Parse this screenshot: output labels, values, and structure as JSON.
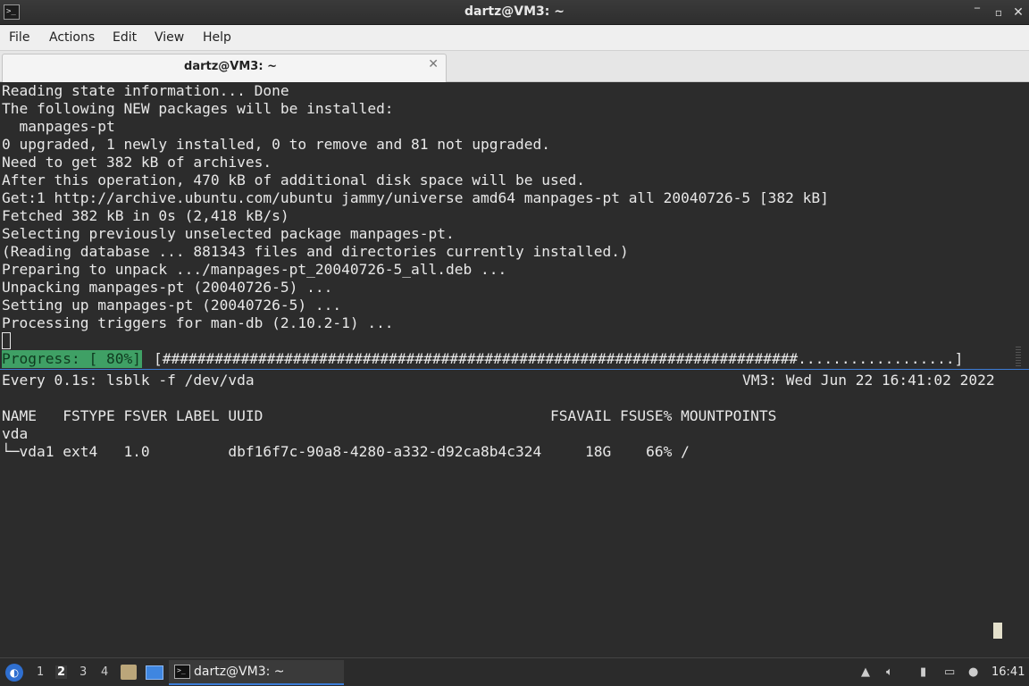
{
  "window": {
    "title": "dartz@VM3: ~",
    "icon": "terminal-icon",
    "controls": {
      "minimize": "‾",
      "maximize": "▫",
      "close": "✕"
    }
  },
  "menubar": {
    "items": [
      "File",
      "Actions",
      "Edit",
      "View",
      "Help"
    ]
  },
  "tabs": [
    {
      "label": "dartz@VM3: ~",
      "close": "✕"
    }
  ],
  "top_pane": {
    "lines": [
      "Reading state information... Done",
      "The following NEW packages will be installed:",
      "  manpages-pt",
      "0 upgraded, 1 newly installed, 0 to remove and 81 not upgraded.",
      "Need to get 382 kB of archives.",
      "After this operation, 470 kB of additional disk space will be used.",
      "Get:1 http://archive.ubuntu.com/ubuntu jammy/universe amd64 manpages-pt all 20040726-5 [382 kB]",
      "Fetched 382 kB in 0s (2,418 kB/s)",
      "Selecting previously unselected package manpages-pt.",
      "(Reading database ... 881343 files and directories currently installed.)",
      "Preparing to unpack .../manpages-pt_20040726-5_all.deb ...",
      "Unpacking manpages-pt (20040726-5) ...",
      "Setting up manpages-pt (20040726-5) ...",
      "Processing triggers for man-db (2.10.2-1) ..."
    ],
    "progress_label": "Progress: [ 80%]",
    "progress_bar": "[#########################################################################..................]",
    "progress_value": 0.8
  },
  "bottom_pane": {
    "watch_header": "Every 0.1s: lsblk -f /dev/vda",
    "watch_status": "VM3: Wed Jun 22 16:41:02 2022",
    "lines": [
      "NAME   FSTYPE FSVER LABEL UUID                                 FSAVAIL FSUSE% MOUNTPOINTS",
      "vda",
      "└─vda1 ext4   1.0         dbf16f7c-90a8-4280-a332-d92ca8b4c324     18G    66% /"
    ]
  },
  "taskbar": {
    "start_icon": "lubuntu-start-icon",
    "workspaces": [
      "1",
      "2",
      "3",
      "4"
    ],
    "active_workspace": "2",
    "task_label": "dartz@VM3: ~",
    "clock": "16:41",
    "tray_icons": [
      "network-icon",
      "volume-icon",
      "clipboard-icon",
      "display-icon",
      "notification-icon"
    ]
  },
  "colors": {
    "terminal_bg": "#2c2c2c",
    "terminal_fg": "#e8e8e8",
    "progress_green": "#3fa065",
    "accent": "#3c7cd6"
  }
}
